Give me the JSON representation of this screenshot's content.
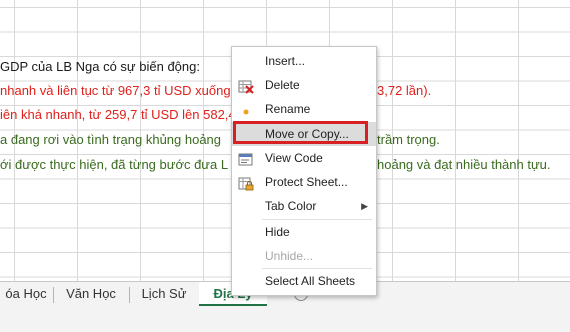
{
  "rows": [
    {
      "text": "GDP của LB Nga có sự biến động:",
      "color": "#1a1a1a"
    },
    {
      "text": "nhanh và liên tục từ 967,3 tỉ USD xuống",
      "tail": "3,72 lần).",
      "color": "#e0201b"
    },
    {
      "text": "iên khá nhanh, từ 259,7 tỉ USD lên 582,4",
      "color": "#e0201b"
    },
    {
      "text": "a đang rơi vào tình trạng khủng hoảng",
      "tail": "trầm trọng.",
      "color": "#3a6b1f"
    },
    {
      "text": "ới được thực hiện, đã từng bước đưa L",
      "tail": "hoảng và đạt nhiều thành tựu.",
      "color": "#3a6b1f"
    }
  ],
  "tabs": [
    {
      "label": "óa Học"
    },
    {
      "label": "Văn Học"
    },
    {
      "label": "Lịch Sử"
    },
    {
      "label": "Địa Lý",
      "active": true
    }
  ],
  "add_sheet_symbol": "+",
  "context_menu": {
    "items": [
      {
        "label": "Insert...",
        "icon": "insert-icon",
        "enabled": true
      },
      {
        "label": "Delete",
        "icon": "delete-sheet-icon",
        "enabled": true
      },
      {
        "label": "Rename",
        "icon": "rename-icon",
        "enabled": true
      },
      {
        "label": "Move or Copy...",
        "icon": "",
        "enabled": true,
        "highlighted": true
      },
      {
        "label": "View Code",
        "icon": "view-code-icon",
        "enabled": true
      },
      {
        "label": "Protect Sheet...",
        "icon": "protect-sheet-icon",
        "enabled": true
      },
      {
        "label": "Tab Color",
        "icon": "",
        "enabled": true,
        "submenu": true
      },
      {
        "label": "Hide",
        "icon": "",
        "enabled": true
      },
      {
        "label": "Unhide...",
        "icon": "",
        "enabled": false
      },
      {
        "label": "Select All Sheets",
        "icon": "",
        "enabled": true
      }
    ],
    "submenu_arrow": "▶"
  },
  "colors": {
    "accent_green": "#217346",
    "highlight_border": "#d62024",
    "text_red": "#e0201b",
    "text_green": "#3a6b1f"
  }
}
